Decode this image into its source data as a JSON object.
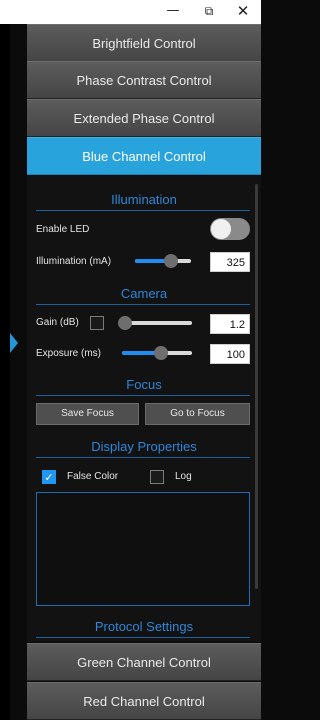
{
  "window": {
    "minimize_glyph": "—",
    "maximize_glyph": "⧉",
    "close_glyph": "✕"
  },
  "sections": {
    "brightfield": "Brightfield Control",
    "phase_contrast": "Phase Contrast Control",
    "extended_phase": "Extended Phase Control",
    "blue_channel": "Blue Channel Control",
    "green_channel": "Green Channel Control",
    "red_channel": "Red Channel Control"
  },
  "illumination": {
    "title": "Illumination",
    "enable_led_label": "Enable LED",
    "enable_led_on": false,
    "illum_label": "Illumination (mA)",
    "illum_value": "325",
    "illum_slider_fraction": 0.64
  },
  "camera": {
    "title": "Camera",
    "gain_label": "Gain (dB)",
    "gain_checked": false,
    "gain_value": "1.2",
    "gain_slider_fraction": 0.04,
    "exposure_label": "Exposure (ms)",
    "exposure_value": "100",
    "exposure_slider_fraction": 0.55
  },
  "focus": {
    "title": "Focus",
    "save_label": "Save Focus",
    "goto_label": "Go to Focus"
  },
  "display": {
    "title": "Display Properties",
    "false_color_label": "False Color",
    "false_color_checked": true,
    "log_label": "Log",
    "log_checked": false
  },
  "protocol": {
    "title": "Protocol Settings"
  },
  "colors": {
    "accent": "#29a3dc",
    "sub_title": "#2e86d8",
    "slider_fill": "#1e8cf0"
  },
  "icons": {
    "side_panel": "expand-arrow-icon",
    "check": "checkmark-icon"
  }
}
